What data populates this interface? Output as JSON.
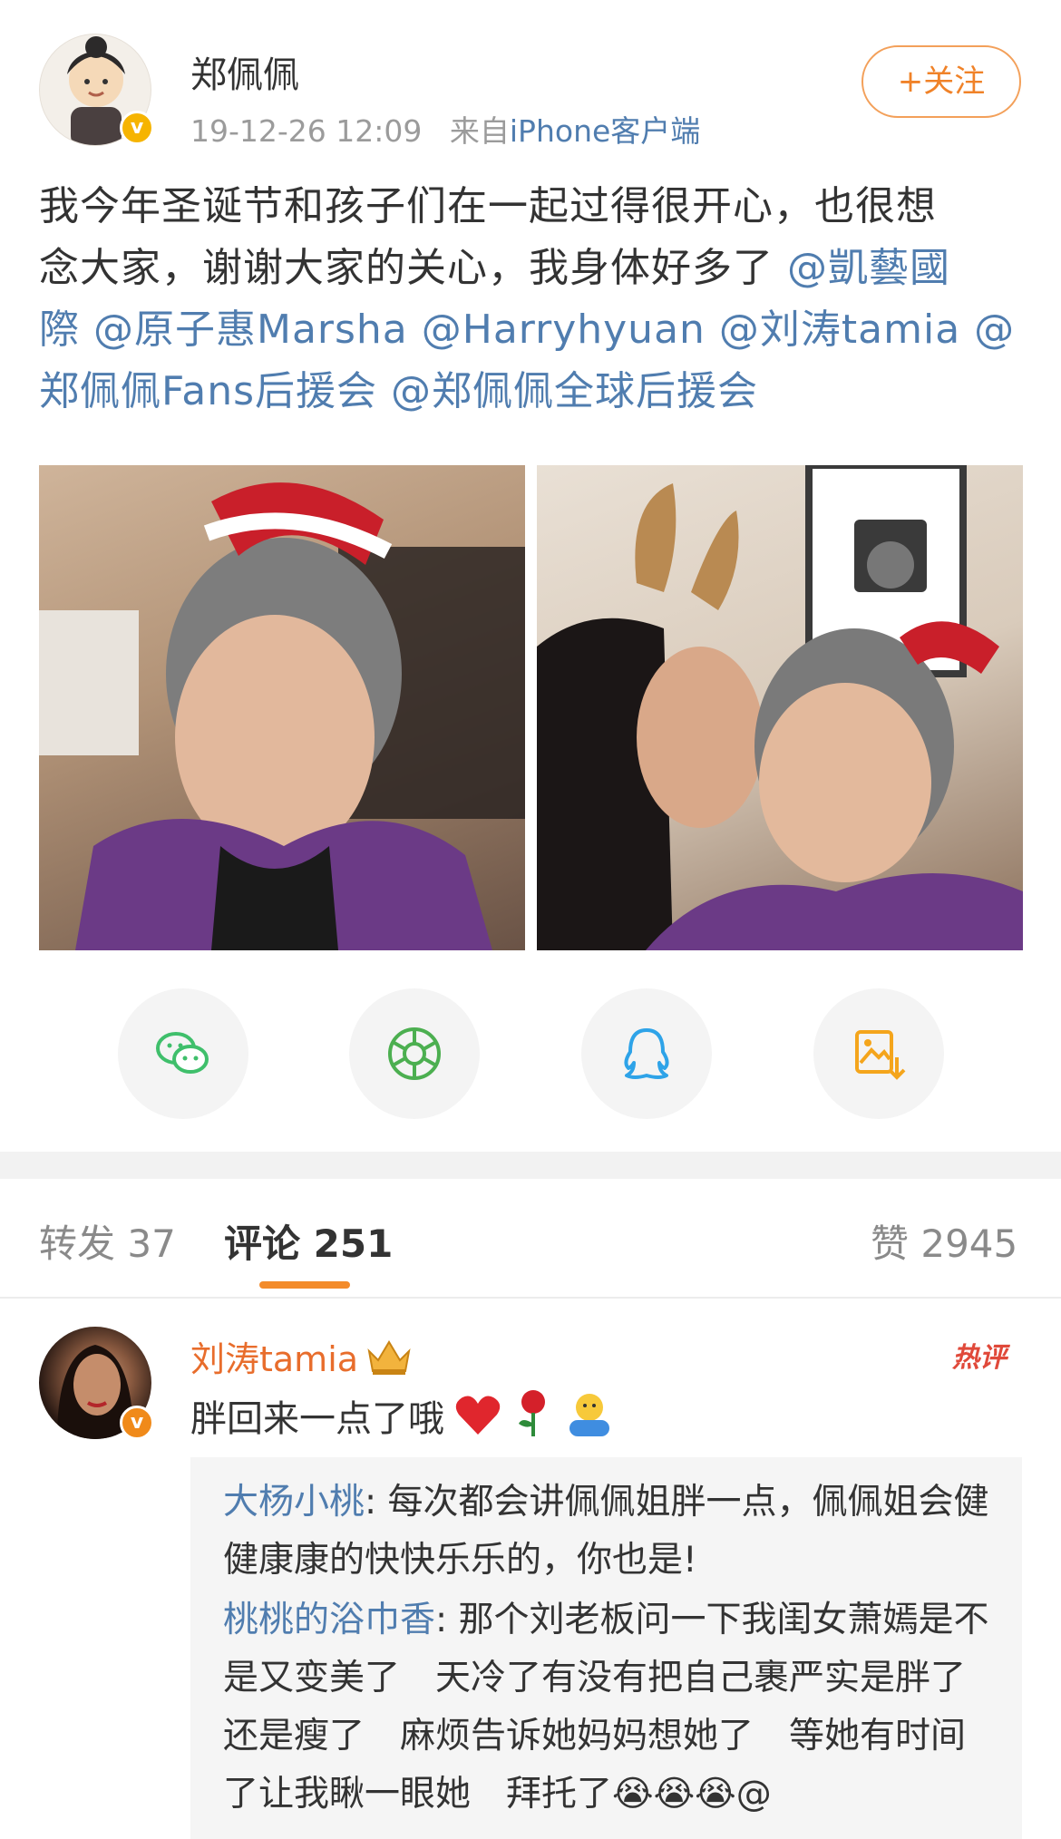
{
  "post": {
    "username": "郑佩佩",
    "timestamp": "19-12-26 12:09",
    "source_prefix": "来自",
    "source": "iPhone客户端",
    "follow_label": "+关注",
    "text_lines": [
      {
        "plain": "我今年圣诞节和孩子们在一起过得很开心，也很想"
      },
      {
        "plain": "念大家，谢谢大家的关心，我身体好多了 ",
        "mention": "@凱藝國"
      },
      {
        "mention": "際 @原子惠Marsha @Harryhyuan @刘涛tamia @"
      },
      {
        "mention": "郑佩佩Fans后援会 @郑佩佩全球后援会"
      }
    ],
    "photos": [
      "photo-1",
      "photo-2"
    ]
  },
  "share_buttons": [
    {
      "icon": "wechat-icon",
      "color": "#3fbf6b"
    },
    {
      "icon": "moments-icon",
      "color": "#4caf50"
    },
    {
      "icon": "qq-icon",
      "color": "#2ea3e8"
    },
    {
      "icon": "save-image-icon",
      "color": "#f4a51c"
    }
  ],
  "tabs": {
    "repost": "转发 37",
    "comments": "评论 251",
    "likes": "赞 2945"
  },
  "comment": {
    "username": "刘涛tamia",
    "hot_badge": "热评",
    "text": "胖回来一点了哦",
    "replies": [
      {
        "name": "大杨小桃",
        "text": ": 每次都会讲佩佩姐胖一点，佩佩姐会健健康康的快快乐乐的，你也是!"
      },
      {
        "name": "桃桃的浴巾香",
        "text": ": 那个刘老板问一下我闺女萧嫣是不是又变美了　天冷了有没有把自己裹严实是胖了还是瘦了　麻烦告诉她妈妈想她了　等她有时间了让我瞅一眼她　拜托了😭😭😭@"
      }
    ]
  },
  "colors": {
    "link": "#507daf",
    "accent": "#f08228",
    "comment_user": "#e86d2c",
    "hot": "#e0493a"
  }
}
